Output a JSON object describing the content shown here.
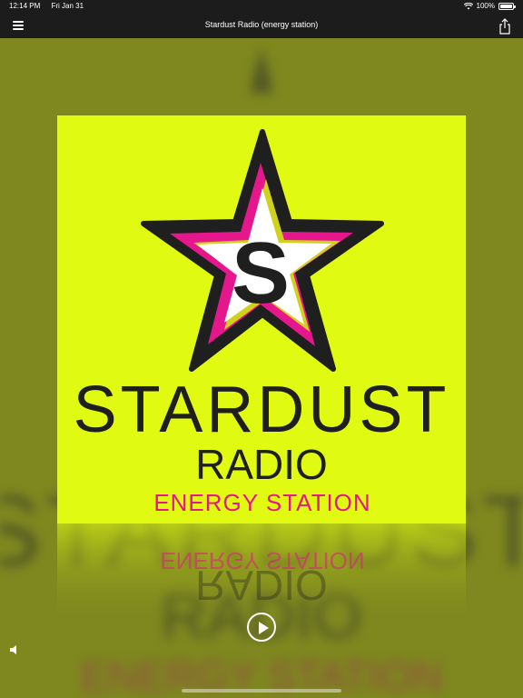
{
  "status_bar": {
    "time": "12:14 PM",
    "date": "Fri Jan 31",
    "battery_percent": "100%",
    "battery_level": 1.0
  },
  "nav": {
    "title": "Stardust Radio (energy station)",
    "menu_icon": "hamburger-icon",
    "share_icon": "share-icon"
  },
  "artwork": {
    "brand_line1": "STARDUST",
    "brand_line2": "RADIO",
    "tagline": "ENERGY STATION",
    "background_color": "#e0fa12",
    "star_color": "#1f1f1f",
    "accent_pink": "#e6178c",
    "accent_yellow": "#cfd11c"
  },
  "player": {
    "play_icon": "play-icon",
    "volume_icon": "speaker-icon"
  },
  "colors": {
    "bar_bg": "#1c1c1c",
    "page_bg": "#7e881f"
  }
}
